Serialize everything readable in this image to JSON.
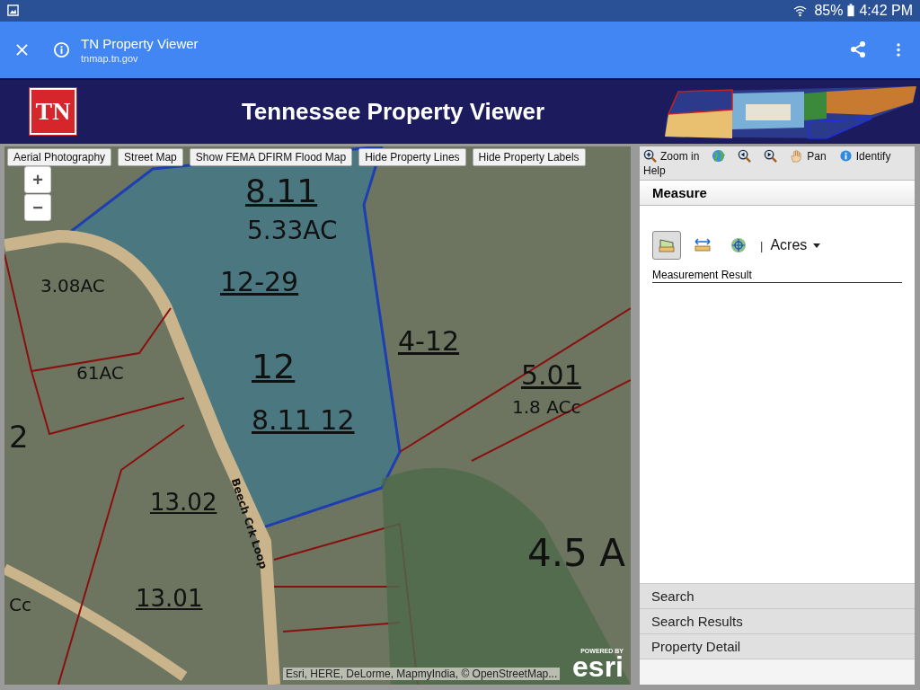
{
  "status_bar": {
    "battery": "85%",
    "time": "4:42 PM"
  },
  "browser_bar": {
    "title": "TN Property Viewer",
    "url": "tnmap.tn.gov"
  },
  "banner": {
    "logo": "TN",
    "title": "Tennessee Property Viewer"
  },
  "map": {
    "layer_buttons": [
      "Aerial Photography",
      "Street Map",
      "Show FEMA DFIRM Flood Map",
      "Hide Property Lines",
      "Hide Property Labels"
    ],
    "zoom_buttons": [
      "+",
      "−"
    ],
    "labels": [
      {
        "text": "8.11",
        "underlined": true
      },
      {
        "text": "5.33AC",
        "underlined": false
      },
      {
        "text": "12-29",
        "underlined": true
      },
      {
        "text": "12",
        "underlined": true
      },
      {
        "text": "8.11  12",
        "underlined": true
      },
      {
        "text": "4-12",
        "underlined": true
      },
      {
        "text": "5.01",
        "underlined": true
      },
      {
        "text": "1.8 ACc",
        "underlined": false
      },
      {
        "text": "3.08AC",
        "underlined": false
      },
      {
        "text": "61AC",
        "underlined": false
      },
      {
        "text": "13.02",
        "underlined": true
      },
      {
        "text": "13.01",
        "underlined": true
      },
      {
        "text": "4.5 A",
        "underlined": false
      },
      {
        "text": "Beech Crk Loop",
        "underlined": false
      },
      {
        "text": "2",
        "underlined": false
      },
      {
        "text": "Cc",
        "underlined": false
      }
    ],
    "attribution": "Esri, HERE, DeLorme, MapmyIndia, © OpenStreetMap...",
    "powered_by": "POWERED BY",
    "brand": "esri"
  },
  "toolbar": [
    {
      "kind": "zoom-in",
      "label": "Zoom in"
    },
    {
      "kind": "globe"
    },
    {
      "kind": "back"
    },
    {
      "kind": "forward"
    },
    {
      "kind": "pan",
      "label": "Pan"
    },
    {
      "kind": "identify",
      "label": "Identify"
    },
    {
      "kind": "none",
      "label": "Help"
    }
  ],
  "measure": {
    "title": "Measure",
    "tools": [
      {
        "kind": "area",
        "selected": true
      },
      {
        "kind": "distance",
        "selected": false
      },
      {
        "kind": "location",
        "selected": false
      }
    ],
    "separator": "|",
    "unit": "Acres",
    "result_label": "Measurement Result"
  },
  "accordion": [
    "Search",
    "Search Results",
    "Property Detail"
  ]
}
